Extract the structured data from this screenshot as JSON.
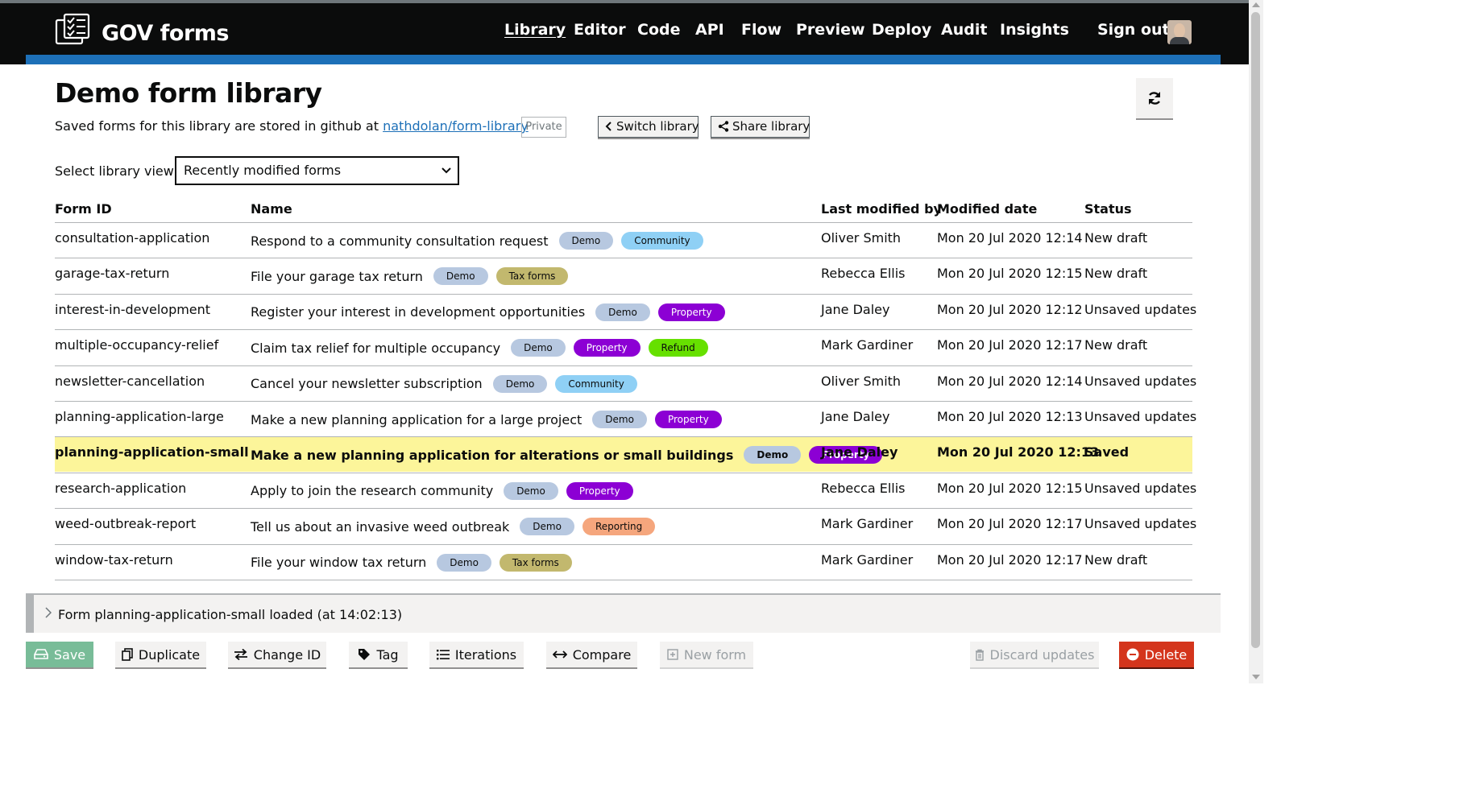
{
  "header": {
    "brand": "GOV forms",
    "nav": [
      {
        "label": "Library",
        "active": true
      },
      {
        "label": "Editor"
      },
      {
        "label": "Code"
      },
      {
        "label": "API"
      },
      {
        "label": "Flow"
      },
      {
        "label": "Preview"
      },
      {
        "label": "Deploy"
      },
      {
        "label": "Audit"
      },
      {
        "label": "Insights"
      }
    ],
    "sign_out": "Sign out"
  },
  "page": {
    "title": "Demo form library",
    "desc_prefix": "Saved forms for this library are stored in github at",
    "repo_link": "nathdolan/form-library",
    "private_badge": "Private",
    "switch_library": "Switch library",
    "share_library": "Share library"
  },
  "view": {
    "label": "Select library view",
    "selected": "Recently modified forms"
  },
  "table": {
    "headers": [
      "Form ID",
      "Name",
      "Last modified by",
      "Modified date",
      "Status"
    ],
    "rows": [
      {
        "id": "consultation-application",
        "name": "Respond to a community consultation request",
        "tags": [
          "Demo",
          "Community"
        ],
        "by": "Oliver Smith",
        "date": "Mon 20 Jul 2020 12:14",
        "status": "New draft"
      },
      {
        "id": "garage-tax-return",
        "name": "File your garage tax return",
        "tags": [
          "Demo",
          "Tax forms"
        ],
        "by": "Rebecca Ellis",
        "date": "Mon 20 Jul 2020 12:15",
        "status": "New draft"
      },
      {
        "id": "interest-in-development",
        "name": "Register your interest in development opportunities",
        "tags": [
          "Demo",
          "Property"
        ],
        "by": "Jane Daley",
        "date": "Mon 20 Jul 2020 12:12",
        "status": "Unsaved updates"
      },
      {
        "id": "multiple-occupancy-relief",
        "name": "Claim tax relief for multiple occupancy",
        "tags": [
          "Demo",
          "Property",
          "Refund"
        ],
        "by": "Mark Gardiner",
        "date": "Mon 20 Jul 2020 12:17",
        "status": "New draft"
      },
      {
        "id": "newsletter-cancellation",
        "name": "Cancel your newsletter subscription",
        "tags": [
          "Demo",
          "Community"
        ],
        "by": "Oliver Smith",
        "date": "Mon 20 Jul 2020 12:14",
        "status": "Unsaved updates"
      },
      {
        "id": "planning-application-large",
        "name": "Make a new planning application for a large project",
        "tags": [
          "Demo",
          "Property"
        ],
        "by": "Jane Daley",
        "date": "Mon 20 Jul 2020 12:13",
        "status": "Unsaved updates"
      },
      {
        "id": "planning-application-small",
        "name": "Make a new planning application for alterations or small buildings",
        "tags": [
          "Demo",
          "Property"
        ],
        "by": "Jane Daley",
        "date": "Mon 20 Jul 2020 12:13",
        "status": "Saved",
        "selected": true
      },
      {
        "id": "research-application",
        "name": "Apply to join the research community",
        "tags": [
          "Demo",
          "Property"
        ],
        "by": "Rebecca Ellis",
        "date": "Mon 20 Jul 2020 12:15",
        "status": "Unsaved updates"
      },
      {
        "id": "weed-outbreak-report",
        "name": "Tell us about an invasive weed outbreak",
        "tags": [
          "Demo",
          "Reporting"
        ],
        "by": "Mark Gardiner",
        "date": "Mon 20 Jul 2020 12:17",
        "status": "Unsaved updates"
      },
      {
        "id": "window-tax-return",
        "name": "File your window tax return",
        "tags": [
          "Demo",
          "Tax forms"
        ],
        "by": "Mark Gardiner",
        "date": "Mon 20 Jul 2020 12:17",
        "status": "New draft"
      }
    ]
  },
  "tag_colors": {
    "Demo": {
      "bg": "#b7c8e0",
      "fg": "#0b0c0c"
    },
    "Community": {
      "bg": "#8fd0f5",
      "fg": "#0b0c0c"
    },
    "Tax forms": {
      "bg": "#c2b86e",
      "fg": "#0b0c0c"
    },
    "Property": {
      "bg": "#8c00d4",
      "fg": "#ffffff"
    },
    "Refund": {
      "bg": "#66e000",
      "fg": "#0b0c0c"
    },
    "Reporting": {
      "bg": "#f5a67d",
      "fg": "#0b0c0c"
    }
  },
  "log": {
    "message": "Form planning-application-small loaded (at 14:02:13)"
  },
  "actions": {
    "save": "Save",
    "duplicate": "Duplicate",
    "change_id": "Change ID",
    "tag": "Tag",
    "iterations": "Iterations",
    "compare": "Compare",
    "new_form": "New form",
    "discard": "Discard updates",
    "delete": "Delete"
  },
  "colors": {
    "header_bg": "#0b0c0c",
    "accent_blue": "#1d70b8",
    "selected_row": "#fcf59a",
    "delete_red": "#d4351c",
    "save_green": "#78bc98"
  }
}
